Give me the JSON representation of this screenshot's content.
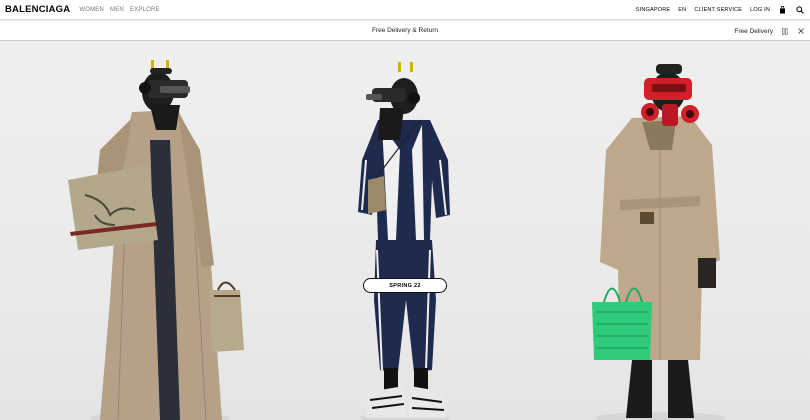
{
  "header": {
    "logo": "BALENCIAGA",
    "nav": [
      "WOMEN",
      "MEN",
      "EXPLORE"
    ],
    "region": "SINGAPORE",
    "language": "EN",
    "client_service": "CLIENT SERVICE",
    "login": "LOG IN"
  },
  "promo": {
    "message": "Free Delivery & Return",
    "right_label": "Free Delivery"
  },
  "hero": {
    "cta_label": "SPRING 22"
  },
  "icons": {
    "bag": "shopping-bag-icon",
    "search": "search-icon",
    "pause": "pause-icon",
    "close": "close-icon"
  }
}
